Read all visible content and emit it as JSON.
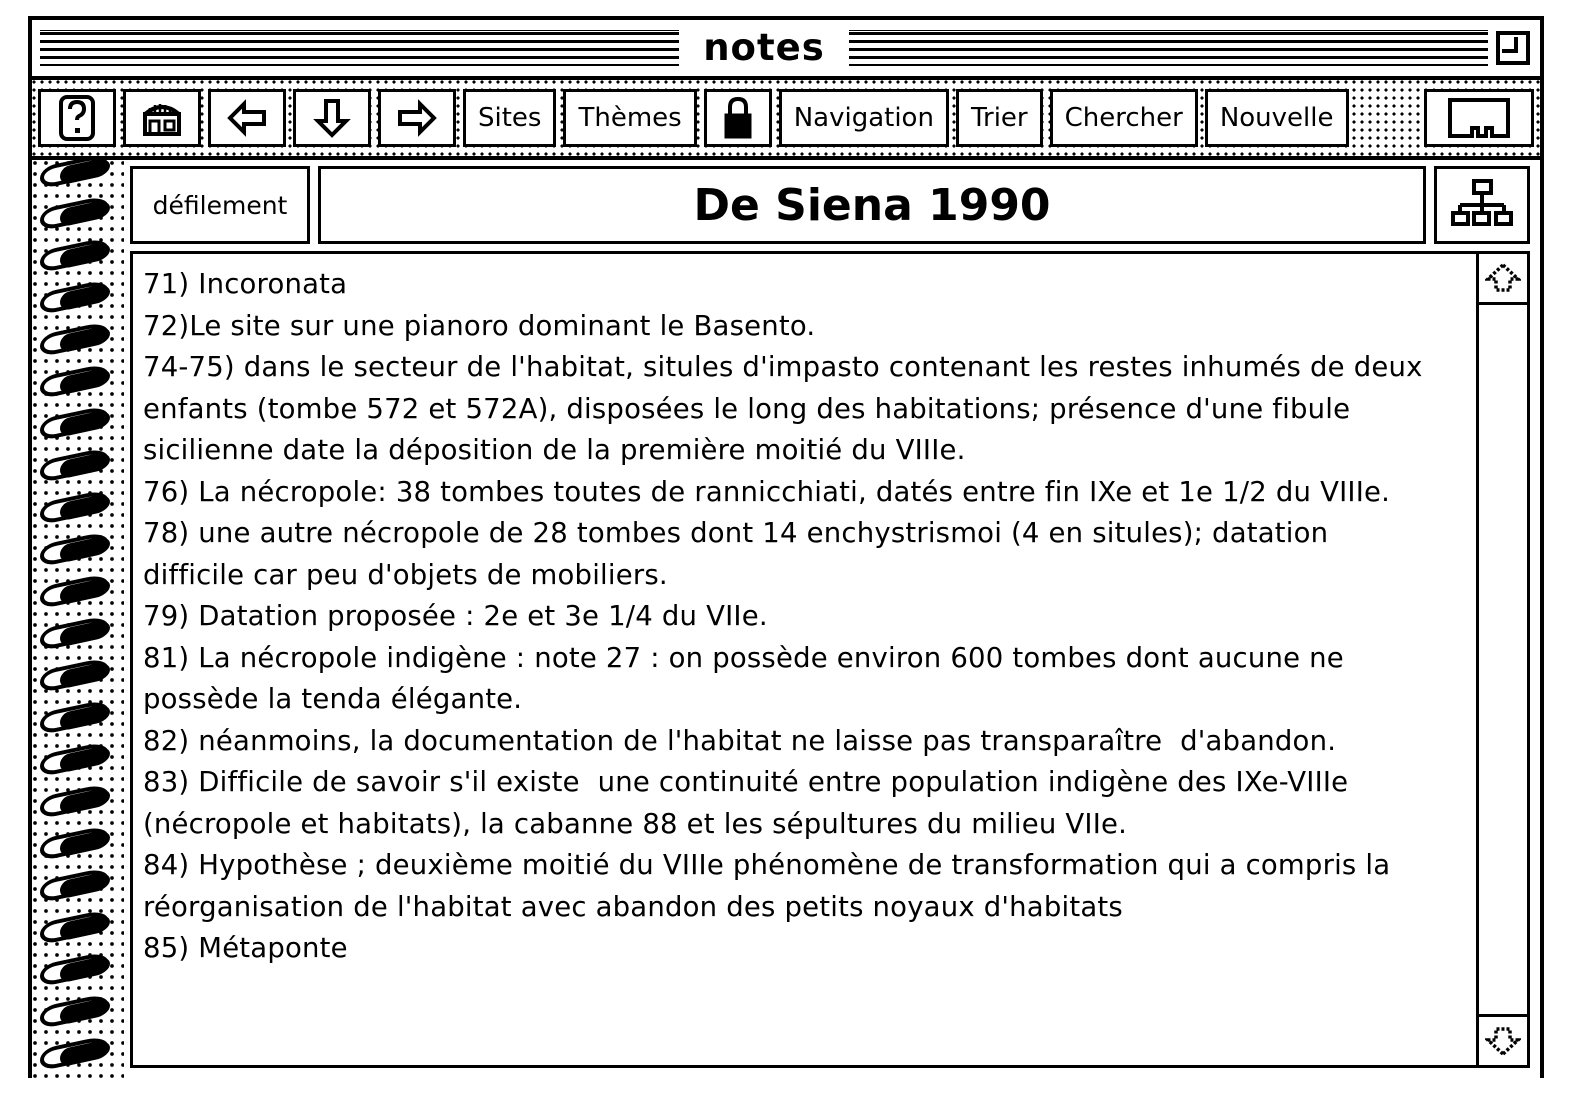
{
  "window": {
    "title": "notes",
    "zoom_box_icon": "zoom-box-icon",
    "close_region": "title-bar-lines"
  },
  "toolbar": {
    "buttons": [
      {
        "id": "help",
        "label": "?",
        "icon": "question-mark-icon",
        "type": "icon"
      },
      {
        "id": "home",
        "label": "",
        "icon": "home-building-icon",
        "type": "icon"
      },
      {
        "id": "back",
        "label": "",
        "icon": "arrow-left-icon",
        "type": "icon"
      },
      {
        "id": "down",
        "label": "",
        "icon": "arrow-down-icon",
        "type": "icon"
      },
      {
        "id": "forward",
        "label": "",
        "icon": "arrow-right-icon",
        "type": "icon"
      },
      {
        "id": "sites",
        "label": "Sites",
        "icon": "",
        "type": "text"
      },
      {
        "id": "themes",
        "label": "Thèmes",
        "icon": "",
        "type": "text"
      },
      {
        "id": "lock",
        "label": "",
        "icon": "padlock-icon",
        "type": "icon"
      },
      {
        "id": "navigation",
        "label": "Navigation",
        "icon": "",
        "type": "text"
      },
      {
        "id": "trier",
        "label": "Trier",
        "icon": "",
        "type": "text"
      },
      {
        "id": "chercher",
        "label": "Chercher",
        "icon": "",
        "type": "text"
      },
      {
        "id": "nouvelle",
        "label": "Nouvelle",
        "icon": "",
        "type": "text"
      },
      {
        "id": "card",
        "label": "",
        "icon": "card-stack-icon",
        "type": "icon"
      }
    ]
  },
  "card": {
    "scroll_button_label": "défilement",
    "doc_title": "De Siena 1990",
    "hierarchy_button_icon": "hierarchy-tree-icon",
    "note_text": "71) Incoronata\n72)Le site sur une pianoro dominant le Basento.\n74-75) dans le secteur de l'habitat, situles d'impasto contenant les restes inhumés de deux enfants (tombe 572 et 572A), disposées le long des habitations; présence d'une fibule sicilienne date la déposition de la première moitié du VIIIe.\n76) La nécropole: 38 tombes toutes de rannicchiati, datés entre fin IXe et 1e 1/2 du VIIIe.\n78) une autre nécropole de 28 tombes dont 14 enchystrismoi (4 en situles); datation difficile car peu d'objets de mobiliers.\n79) Datation proposée : 2e et 3e 1/4 du VIIe.\n81) La nécropole indigène : note 27 : on possède environ 600 tombes dont aucune ne possède la tenda élégante.\n82) néanmoins, la documentation de l'habitat ne laisse pas transparaître  d'abandon.\n83) Difficile de savoir s'il existe  une continuité entre population indigène des IXe-VIIIe (nécropole et habitats), la cabanne 88 et les sépultures du milieu VIIe.\n84) Hypothèse ; deuxième moitié du VIIIe phénomène de transformation qui a compris la réorganisation de l'habitat avec abandon des petits noyaux d'habitats\n85) Métaponte",
    "note_lines": [
      "71) Incoronata",
      "72)Le site sur une pianoro dominant le Basento.",
      "74-75) dans le secteur de l'habitat, situles d'impasto contenant les restes inhumés de deux",
      "enfants (tombe 572 et 572A), disposées le long des habitations; présence d'une fibule",
      "sicilienne date la déposition de la première moitié du VIIIe.",
      "76) La nécropole: 38 tombes toutes de rannicchiati, datés entre fin IXe et 1e 1/2 du VIIIe.",
      "78) une autre nécropole de 28 tombes dont 14 enchystrismoi (4 en situles); datation",
      "difficile car peu d'objets de mobiliers.",
      "79) Datation proposée : 2e et 3e 1/4 du VIIe.",
      "81) La nécropole indigène : note 27 : on possède environ 600 tombes dont aucune ne",
      "possède la tenda élégante.",
      "82) néanmoins, la documentation de l'habitat ne laisse pas transparaître  d'abandon.",
      "83) Difficile de savoir s'il existe  une continuité entre population indigène des IXe-VIIIe",
      "(nécropole et habitats), la cabanne 88 et les sépultures du milieu VIIe.",
      "84) Hypothèse ; deuxième moitié du VIIIe phénomène de transformation qui a compris la",
      "réorganisation de l'habitat avec abandon des petits noyaux d'habitats",
      "85) Métaponte"
    ]
  },
  "scrollbar": {
    "up_icon": "scroll-up-arrow-icon",
    "down_icon": "scroll-down-arrow-icon"
  },
  "colors": {
    "ink": "#000000",
    "paper": "#ffffff"
  }
}
